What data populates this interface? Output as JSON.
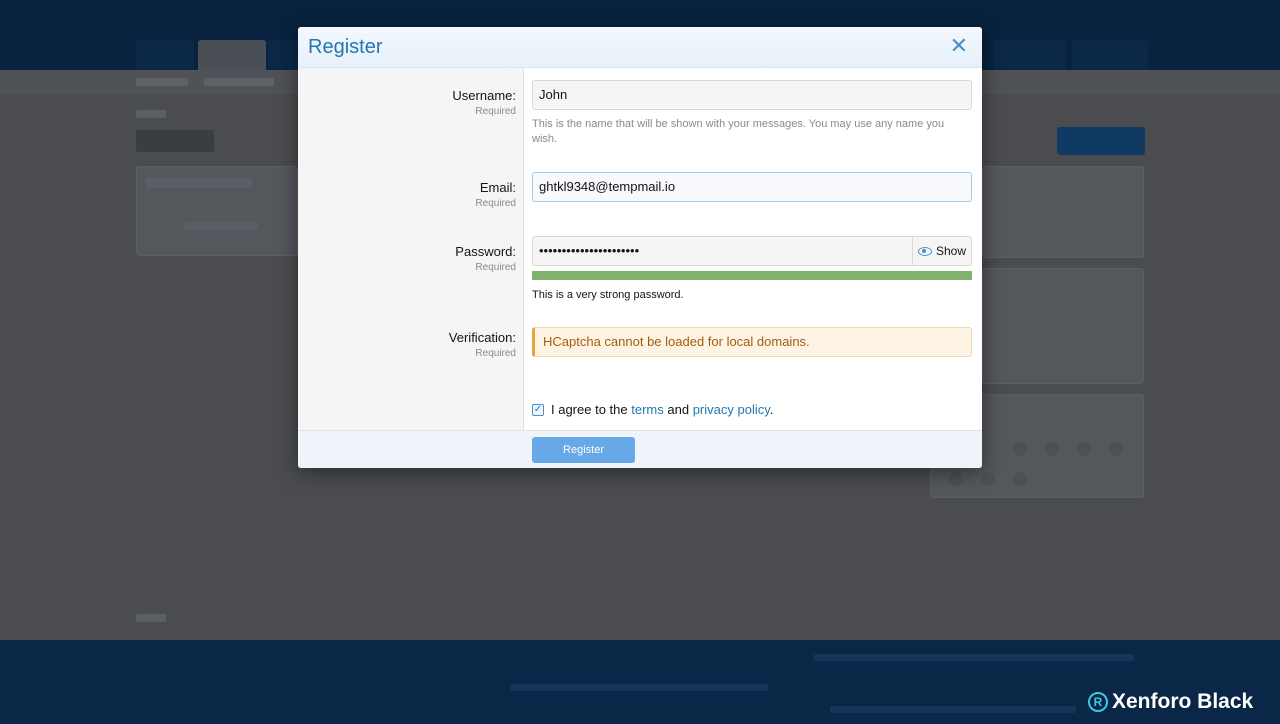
{
  "modal": {
    "title": "Register",
    "close_glyph": "✕",
    "close_icon": "close-icon"
  },
  "form": {
    "username": {
      "label": "Username:",
      "required": "Required",
      "value": "John",
      "hint": "This is the name that will be shown with your messages. You may use any name you wish."
    },
    "email": {
      "label": "Email:",
      "required": "Required",
      "value": "ghtkl9348@tempmail.io"
    },
    "password": {
      "label": "Password:",
      "required": "Required",
      "value": "••••••••••••••••••••••",
      "show_label": "Show",
      "show_icon": "eye-icon",
      "strength_fraction": 1.0,
      "strength_text": "This is a very strong password."
    },
    "verification": {
      "label": "Verification:",
      "required": "Required",
      "notice": "HCaptcha cannot be loaded for local domains."
    },
    "agree": {
      "checked": true,
      "check_glyph": "✓",
      "prefix": "I agree to the",
      "terms_link": "terms",
      "conjunction": "and",
      "privacy_link": "privacy policy",
      "suffix": "."
    },
    "submit_label": "Register"
  },
  "watermark": {
    "badge": "R",
    "text": "Xenforo Black"
  },
  "colors": {
    "accent": "#2577b1",
    "button": "#67a9e7",
    "strength": "#7fb26f",
    "warning_text": "#a85c0b",
    "overlay": "#4a4c4f"
  }
}
